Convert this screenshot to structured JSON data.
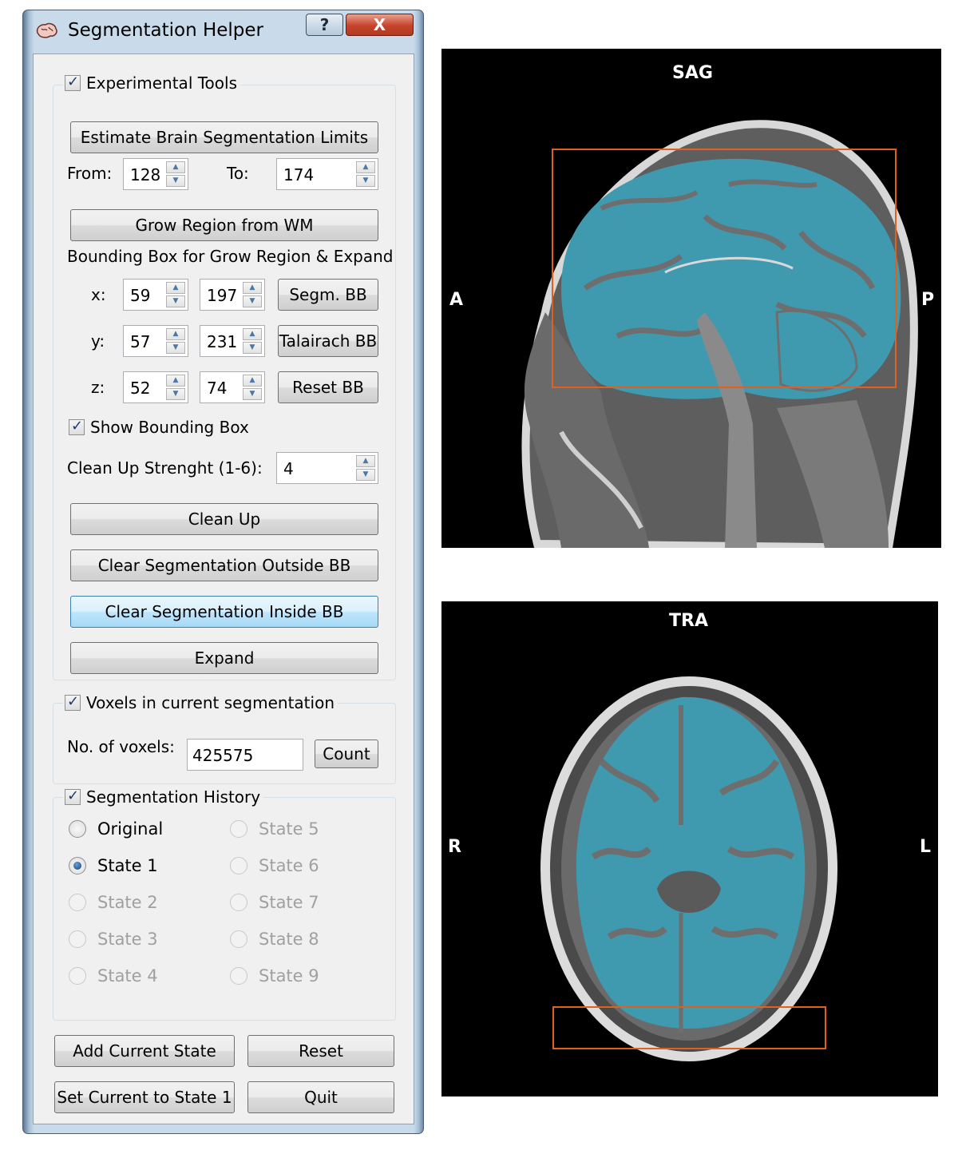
{
  "window": {
    "title": "Segmentation Helper",
    "help_glyph": "?",
    "close_glyph": "X"
  },
  "experimental": {
    "title": "Experimental Tools",
    "estimate_btn": "Estimate Brain Segmentation Limits",
    "from_label": "From:",
    "from_value": "128",
    "to_label": "To:",
    "to_value": "174",
    "grow_btn": "Grow Region from WM",
    "bbox_label": "Bounding Box for Grow Region & Expand",
    "x_label": "x:",
    "x_min": "59",
    "x_max": "197",
    "y_label": "y:",
    "y_min": "57",
    "y_max": "231",
    "z_label": "z:",
    "z_min": "52",
    "z_max": "74",
    "segm_bb_btn": "Segm. BB",
    "talairach_bb_btn": "Talairach BB",
    "reset_bb_btn": "Reset BB",
    "show_bbox_label": "Show Bounding Box",
    "cleanup_label": "Clean Up Strenght (1-6):",
    "cleanup_value": "4",
    "cleanup_btn": "Clean Up",
    "clear_outside_btn": "Clear Segmentation Outside BB",
    "clear_inside_btn": "Clear Segmentation Inside BB",
    "expand_btn": "Expand"
  },
  "voxels": {
    "title": "Voxels in current segmentation",
    "count_label": "No. of voxels:",
    "count_value": "425575",
    "count_btn": "Count"
  },
  "history": {
    "title": "Segmentation History",
    "states": [
      {
        "label": "Original",
        "checked": false,
        "enabled": true
      },
      {
        "label": "State 1",
        "checked": true,
        "enabled": true
      },
      {
        "label": "State 2",
        "checked": false,
        "enabled": false
      },
      {
        "label": "State 3",
        "checked": false,
        "enabled": false
      },
      {
        "label": "State 4",
        "checked": false,
        "enabled": false
      },
      {
        "label": "State 5",
        "checked": false,
        "enabled": false
      },
      {
        "label": "State 6",
        "checked": false,
        "enabled": false
      },
      {
        "label": "State 7",
        "checked": false,
        "enabled": false
      },
      {
        "label": "State 8",
        "checked": false,
        "enabled": false
      },
      {
        "label": "State 9",
        "checked": false,
        "enabled": false
      }
    ],
    "add_state_btn": "Add Current State",
    "reset_btn": "Reset",
    "set_current_btn": "Set Current to State 1",
    "quit_btn": "Quit"
  },
  "views": {
    "sag": {
      "title": "SAG",
      "left": "A",
      "right": "P"
    },
    "tra": {
      "title": "TRA",
      "left": "R",
      "right": "L"
    }
  },
  "colors": {
    "segmentation": "#3f9aaf",
    "bounding_box": "#e0601e",
    "tissue": "#7a7a7a"
  }
}
